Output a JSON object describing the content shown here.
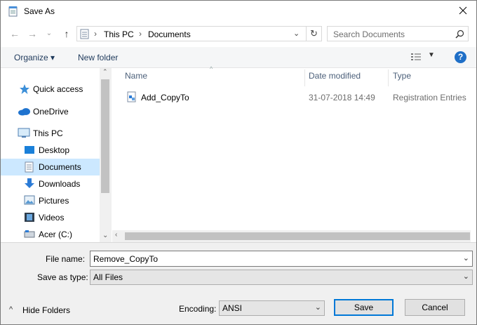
{
  "window": {
    "title": "Save As"
  },
  "address": {
    "crumbs": [
      "This PC",
      "Documents"
    ],
    "search_placeholder": "Search Documents"
  },
  "toolbar": {
    "organize": "Organize ▾",
    "new_folder": "New folder",
    "help": "?"
  },
  "nav": {
    "items": [
      {
        "label": "Quick access",
        "icon": "star-icon",
        "selected": false
      },
      {
        "label": "OneDrive",
        "icon": "cloud-icon",
        "selected": false
      },
      {
        "label": "This PC",
        "icon": "computer-icon",
        "selected": false
      },
      {
        "label": "Desktop",
        "icon": "desktop-icon",
        "selected": false
      },
      {
        "label": "Documents",
        "icon": "documents-icon",
        "selected": true
      },
      {
        "label": "Downloads",
        "icon": "download-arrow-icon",
        "selected": false
      },
      {
        "label": "Pictures",
        "icon": "pictures-icon",
        "selected": false
      },
      {
        "label": "Videos",
        "icon": "videos-icon",
        "selected": false
      },
      {
        "label": "Acer (C:)",
        "icon": "drive-icon",
        "selected": false
      }
    ]
  },
  "columns": {
    "name": "Name",
    "date": "Date modified",
    "type": "Type"
  },
  "files": [
    {
      "name": "Add_CopyTo",
      "date": "31-07-2018 14:49",
      "type": "Registration Entries",
      "icon": "registry-file-icon"
    }
  ],
  "form": {
    "file_name_label": "File name:",
    "file_name_value": "Remove_CopyTo",
    "save_type_label": "Save as type:",
    "save_type_value": "All Files",
    "encoding_label": "Encoding:",
    "encoding_value": "ANSI",
    "hide_folders": "Hide Folders",
    "save": "Save",
    "cancel": "Cancel"
  },
  "colors": {
    "selection": "#cce8ff",
    "accent": "#0078d7",
    "help": "#1f6fc7"
  }
}
